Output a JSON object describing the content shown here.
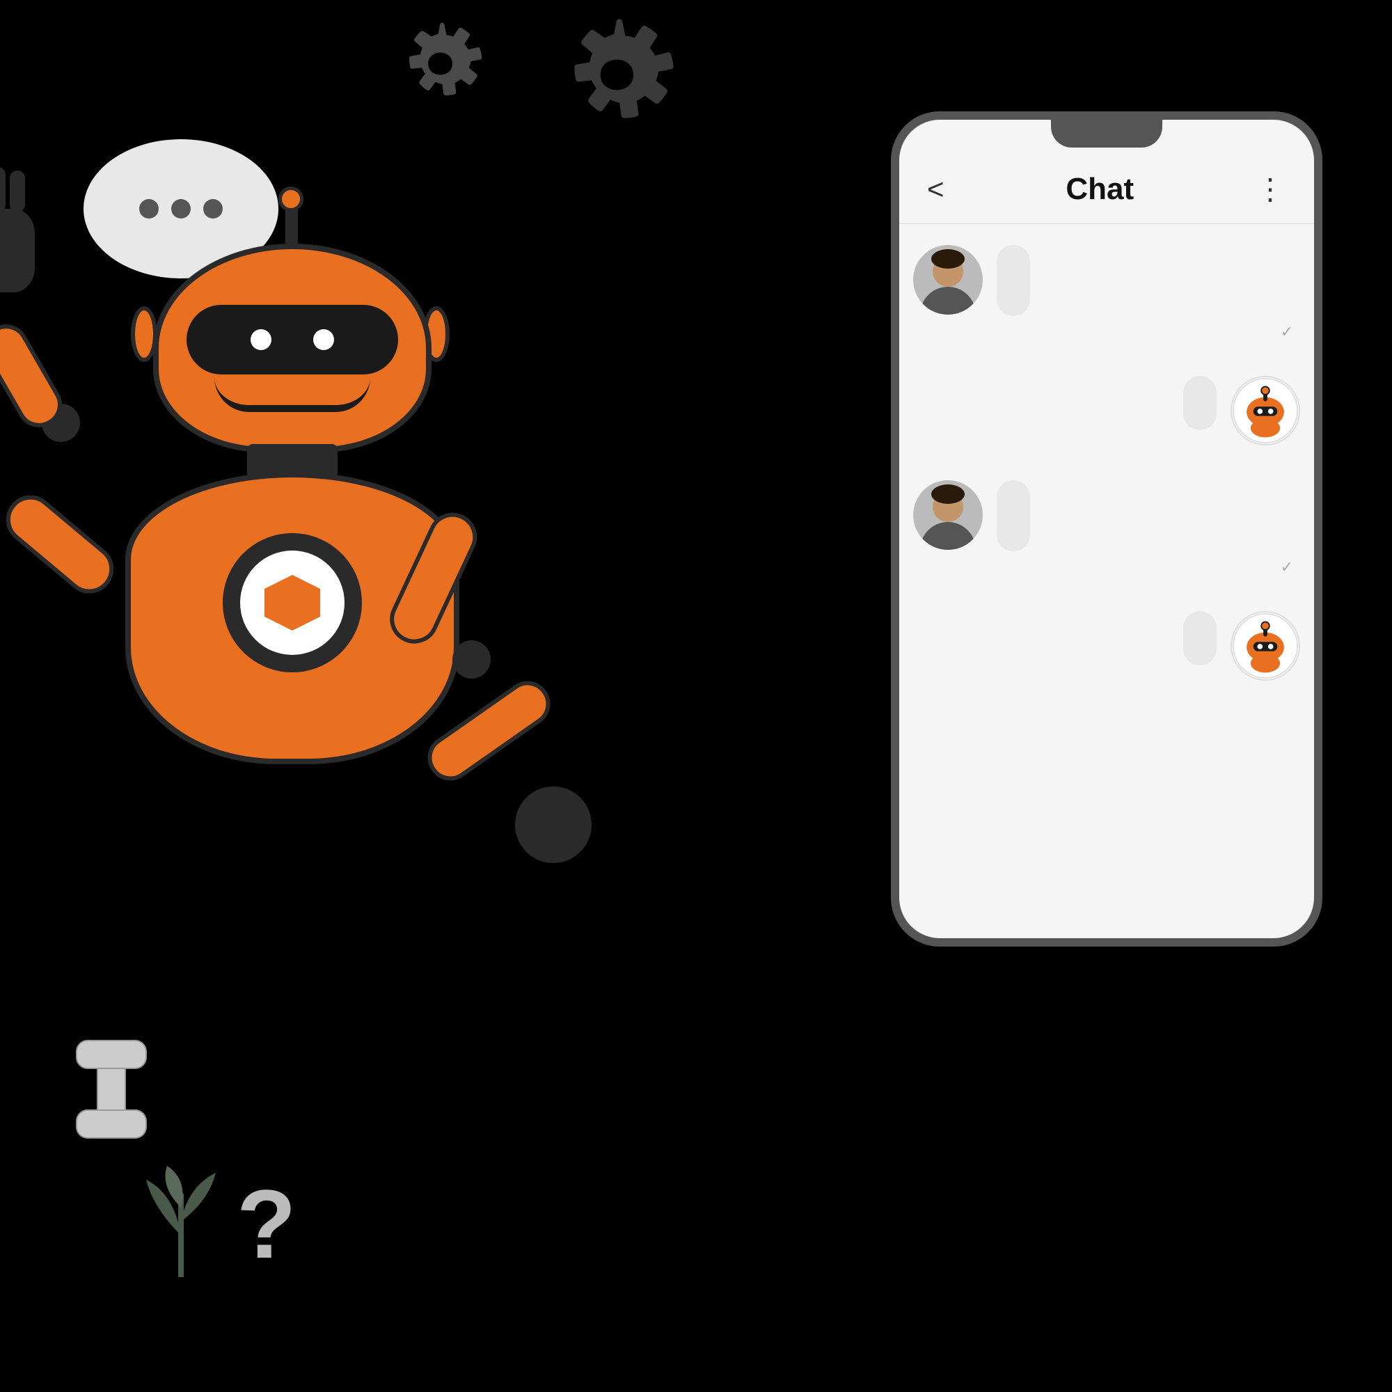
{
  "background": "#000000",
  "colors": {
    "orange": "#e87020",
    "dark": "#2a2a2a",
    "light_gray": "#e8e8e8",
    "medium_gray": "#bbb",
    "phone_bg": "#f5f5f5"
  },
  "chat": {
    "header_title": "Chat",
    "back_arrow": "<",
    "menu_dots": "⋮",
    "messages": [
      {
        "side": "left",
        "avatar": "human",
        "lines": [
          "full",
          "full",
          "medium"
        ]
      },
      {
        "side": "right",
        "avatar": "bot",
        "lines": [
          "full",
          "medium"
        ]
      },
      {
        "side": "left",
        "avatar": "human",
        "lines": [
          "full",
          "full",
          "short"
        ]
      },
      {
        "side": "right",
        "avatar": "bot",
        "lines": [
          "full",
          "medium"
        ]
      }
    ]
  },
  "decorations": {
    "bubble_dots": 3,
    "question_mark": "?",
    "gears": [
      "large-top-center",
      "large-top-right",
      "small-right-middle"
    ]
  }
}
